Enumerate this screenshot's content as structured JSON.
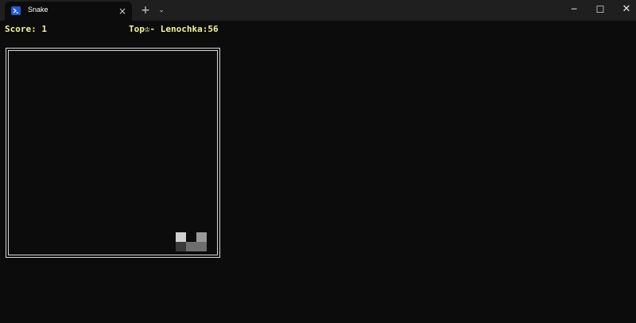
{
  "window": {
    "tab_title": "Snake",
    "tab_icon": "powershell-icon",
    "close_tab_glyph": "×",
    "new_tab_glyph": "+",
    "dropdown_glyph": "⌄",
    "minimize_glyph": "─",
    "maximize_glyph": "☐",
    "close_glyph": "✕"
  },
  "game": {
    "score_text": "Score: 1",
    "top_text": "Top♔- Lenochka:56",
    "colors": {
      "background": "#0c0c0c",
      "status_text": "#f3f39a",
      "border": "#d9d9d9",
      "food": "#d0d0d0",
      "snake_head": "#9a9a9a",
      "snake_body": "#6e6e6e",
      "snake_tail": "#3a3a3a"
    }
  }
}
